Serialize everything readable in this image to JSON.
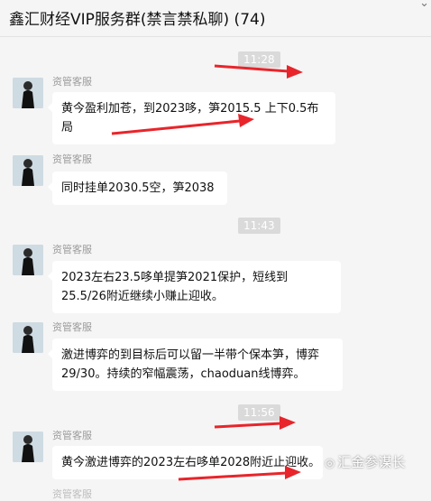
{
  "window": {
    "title": "鑫汇财经VIP服务群(禁言禁私聊) (74)"
  },
  "colors": {
    "background": "#f5f5f5",
    "bubble": "#ffffff",
    "arrow": "#e8252b"
  },
  "messages": [
    {
      "timestamp": "11:28",
      "sender": "资管客服",
      "text": "黄今盈利加苍，到2023哆，笋2015.5 上下0.5布局"
    },
    {
      "sender": "资管客服",
      "text": "同时挂单2030.5空，笋2038"
    },
    {
      "timestamp": "11:43",
      "sender": "资管客服",
      "text": "2023左右23.5哆单提笋2021保护，短线到25.5/26附近继续小赚止迎收。"
    },
    {
      "sender": "资管客服",
      "text": "激进博弈的到目标后可以留一半带个保本笋，博弈29/30。持续的窄幅震荡，chaoduan线博弈。"
    },
    {
      "timestamp": "11:56",
      "sender": "资管客服",
      "text": "黄今激进博弈的2023左右哆单2028附近止迎收。"
    },
    {
      "sender": "资管客服"
    }
  ],
  "watermark": {
    "text": "汇金参谋长",
    "icon": "weibo-icon"
  }
}
